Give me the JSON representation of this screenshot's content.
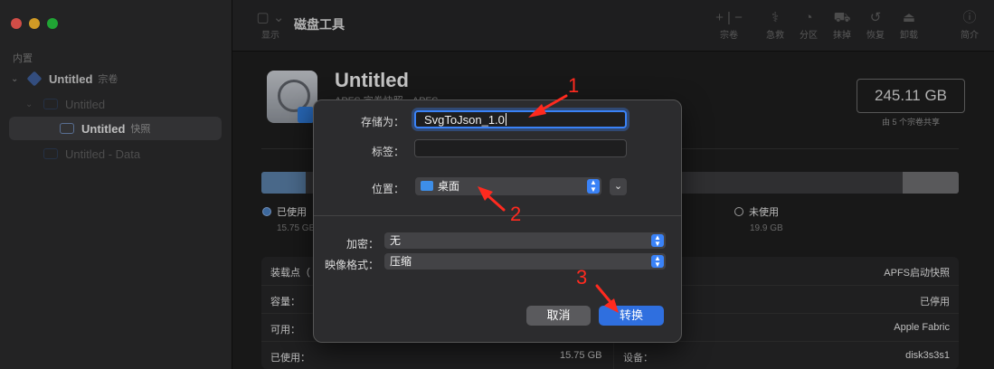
{
  "window": {
    "title": "磁盘工具"
  },
  "sidebar": {
    "section_label": "内置",
    "items": [
      {
        "label": "Untitled",
        "tag": "宗卷"
      },
      {
        "label": "Untitled",
        "tag": ""
      },
      {
        "label": "Untitled",
        "tag": "快照"
      },
      {
        "label": "Untitled - Data",
        "tag": ""
      }
    ]
  },
  "toolbar": {
    "display_label": "显示",
    "volume_label": "宗卷",
    "firstaid_label": "急救",
    "partition_label": "分区",
    "erase_label": "抹掉",
    "restore_label": "恢复",
    "unmount_label": "卸载",
    "info_label": "简介",
    "plus_icon": "plus-icon",
    "minus_icon": "minus-icon"
  },
  "volume": {
    "title": "Untitled",
    "subtitle": "APFS 宗卷快照 • APFS",
    "capacity": "245.11 GB",
    "capacity_note": "由 5 个宗卷共享",
    "used_label": "已使用",
    "used_value": "15.75 GB",
    "free_label": "未使用",
    "free_value": "19.9 GB",
    "used_fraction": 0.064,
    "free_fraction": 0.081
  },
  "info": {
    "mount_label": "装载点（",
    "capacity_label": "容量：",
    "available_label": "可用：",
    "used_label": "已使用：",
    "used_value": "15.75 GB",
    "type_value": "APFS启动快照",
    "status_value": "已停用",
    "connection_value": "Apple Fabric",
    "device_label": "设备：",
    "device_value": "disk3s3s1"
  },
  "dialog": {
    "save_as_label": "存储为：",
    "save_as_value": "SvgToJson_1.0",
    "tags_label": "标签：",
    "tags_value": "",
    "location_label": "位置：",
    "location_value": "桌面",
    "encryption_label": "加密：",
    "encryption_value": "无",
    "format_label": "映像格式：",
    "format_value": "压缩",
    "cancel_label": "取消",
    "convert_label": "转换"
  },
  "annotations": [
    "1",
    "2",
    "3"
  ],
  "colors": {
    "accent": "#3a82f7",
    "annotation": "#ff2a1f",
    "used": "#5a7fa8",
    "free": "#6d6d6f"
  }
}
